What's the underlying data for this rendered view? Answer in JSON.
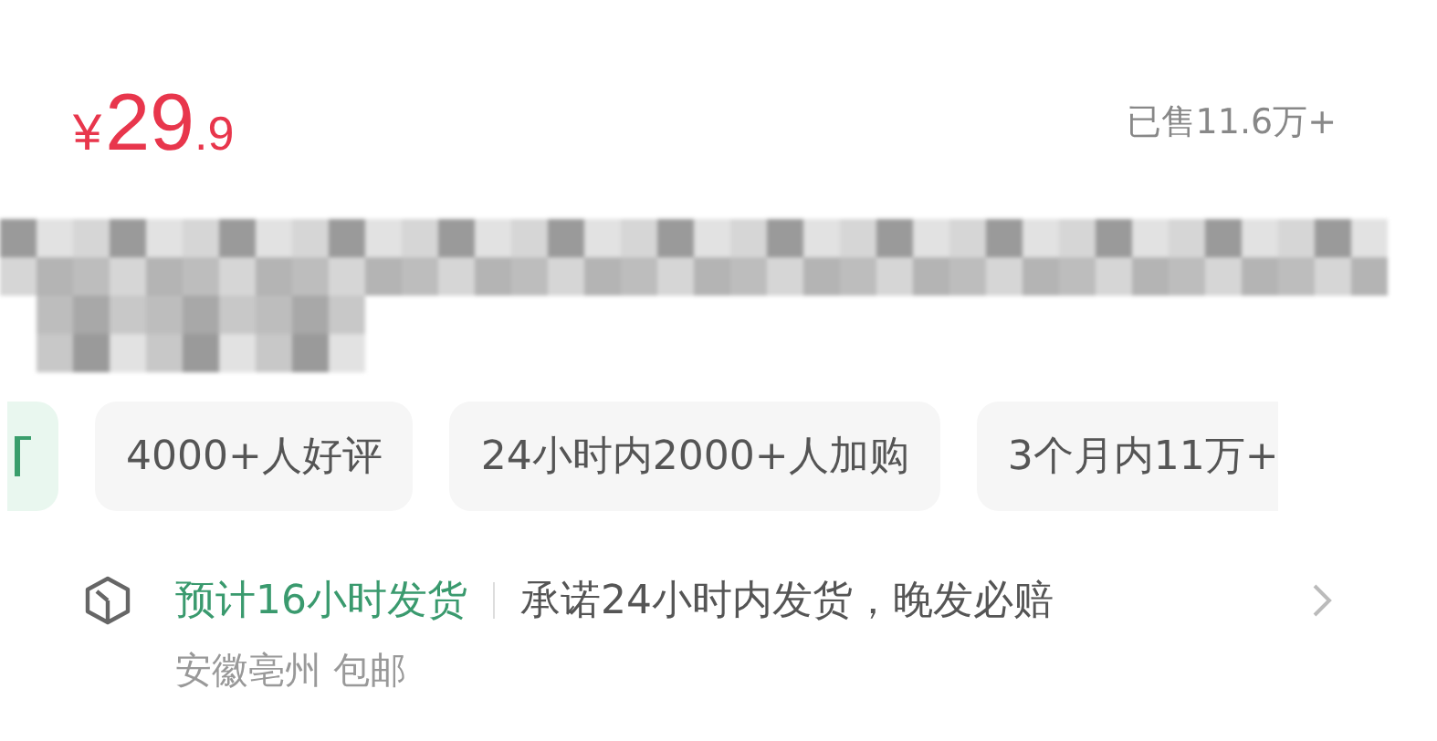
{
  "price": {
    "currency": "¥",
    "integer": "29",
    "decimal": ".9"
  },
  "sold": "已售11.6万+",
  "tags": [
    {
      "kind": "promo"
    },
    {
      "kind": "plain",
      "label": "4000+人好评"
    },
    {
      "kind": "plain",
      "label": "24小时内2000+人加购"
    },
    {
      "kind": "plain",
      "label": "3个月内11万+"
    }
  ],
  "shipping": {
    "estimate": "预计16小时发货",
    "promise": "承诺24小时内发货，晚发必赔",
    "origin": "安徽亳州 包邮"
  }
}
